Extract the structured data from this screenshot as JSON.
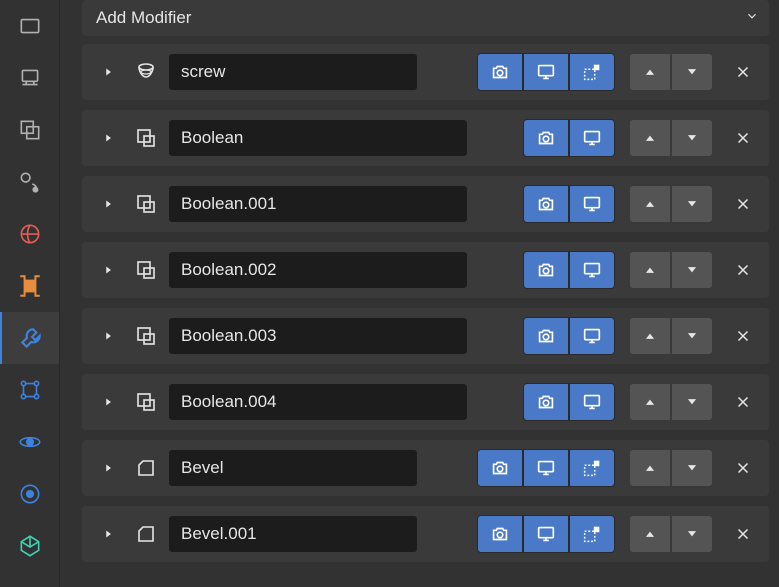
{
  "header": {
    "add_modifier_label": "Add Modifier"
  },
  "sidebar": {
    "tabs": [
      {
        "icon": "tool"
      },
      {
        "icon": "output"
      },
      {
        "icon": "viewlayer"
      },
      {
        "icon": "scene"
      },
      {
        "icon": "world"
      },
      {
        "icon": "object"
      },
      {
        "icon": "modifier"
      },
      {
        "icon": "particles"
      },
      {
        "icon": "physics"
      },
      {
        "icon": "constraints"
      },
      {
        "icon": "data"
      }
    ],
    "active_index": 6
  },
  "modifiers": [
    {
      "type": "screw",
      "name": "screw",
      "toggles": [
        "render",
        "realtime",
        "editmode"
      ]
    },
    {
      "type": "boolean",
      "name": "Boolean",
      "toggles": [
        "render",
        "realtime"
      ]
    },
    {
      "type": "boolean",
      "name": "Boolean.001",
      "toggles": [
        "render",
        "realtime"
      ]
    },
    {
      "type": "boolean",
      "name": "Boolean.002",
      "toggles": [
        "render",
        "realtime"
      ]
    },
    {
      "type": "boolean",
      "name": "Boolean.003",
      "toggles": [
        "render",
        "realtime"
      ]
    },
    {
      "type": "boolean",
      "name": "Boolean.004",
      "toggles": [
        "render",
        "realtime"
      ]
    },
    {
      "type": "bevel",
      "name": "Bevel",
      "toggles": [
        "render",
        "realtime",
        "editmode"
      ]
    },
    {
      "type": "bevel",
      "name": "Bevel.001",
      "toggles": [
        "render",
        "realtime",
        "editmode"
      ]
    }
  ],
  "colors": {
    "accent": "#4a7ac7",
    "panel": "#3a3a3a",
    "input_bg": "#1c1c1c",
    "world_icon": "#e25d56",
    "object_icon": "#e88d3e",
    "modifier_icon": "#3e82e0",
    "particle_icon": "#3e82e0",
    "physics_icon": "#3e82e0",
    "constraint_icon": "#3e82e0",
    "data_icon": "#3ecfb5"
  }
}
